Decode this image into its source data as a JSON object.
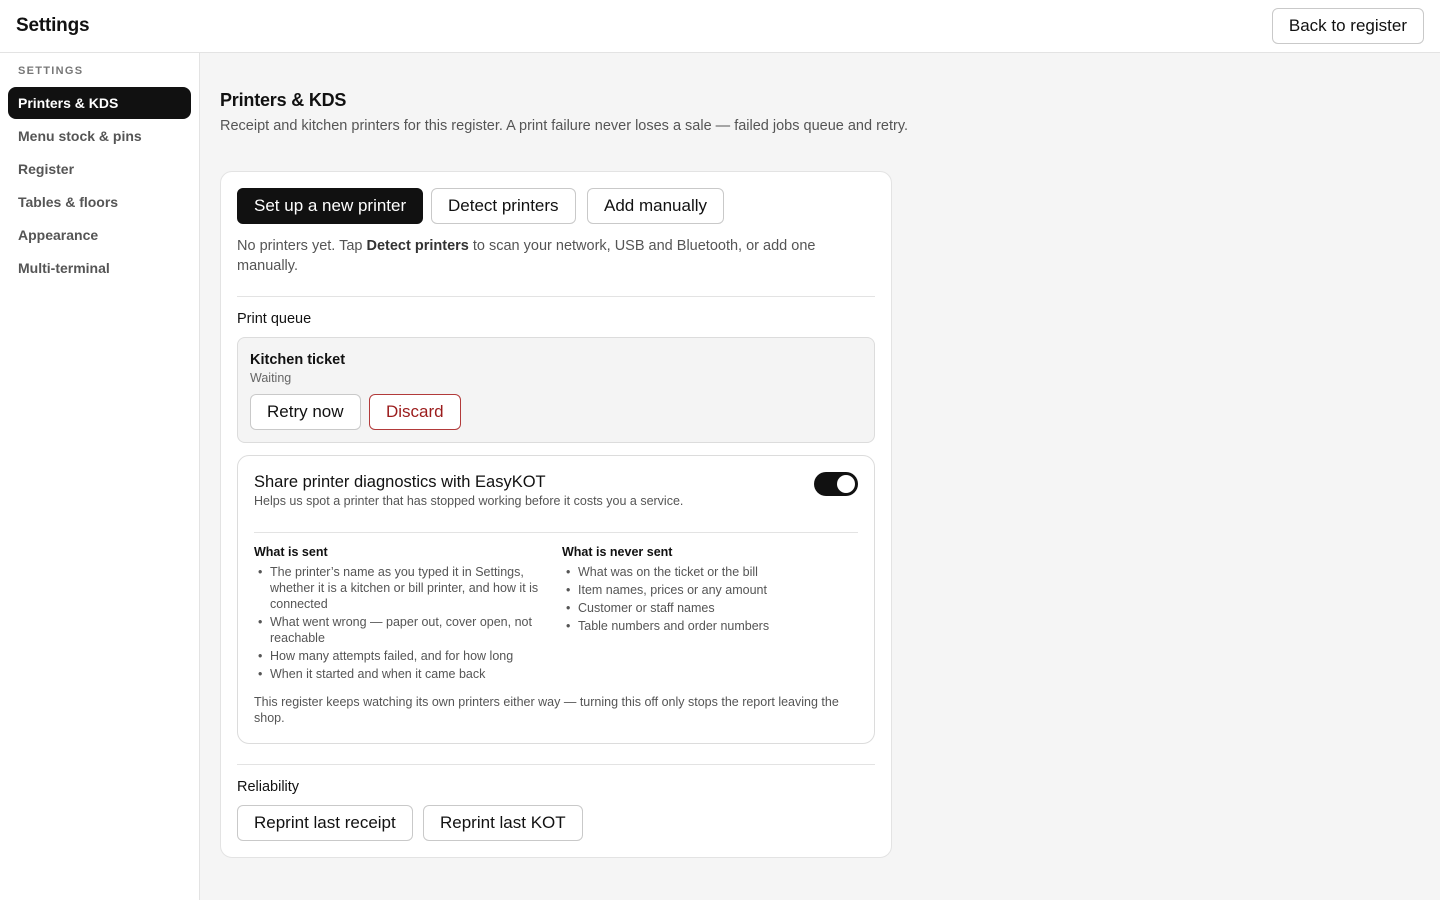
{
  "header": {
    "title": "Settings",
    "back_label": "Back to register"
  },
  "sidebar": {
    "heading": "SETTINGS",
    "items": [
      {
        "label": "Printers & KDS",
        "active": true
      },
      {
        "label": "Menu stock & pins",
        "active": false
      },
      {
        "label": "Register",
        "active": false
      },
      {
        "label": "Tables & floors",
        "active": false
      },
      {
        "label": "Appearance",
        "active": false
      },
      {
        "label": "Multi-terminal",
        "active": false
      }
    ]
  },
  "main": {
    "title": "Printers & KDS",
    "description": "Receipt and kitchen printers for this register. A print failure never loses a sale — failed jobs queue and retry.",
    "actions": {
      "setup_label": "Set up a new printer",
      "detect_label": "Detect printers",
      "manual_label": "Add manually"
    },
    "empty": {
      "before": "No printers yet. Tap ",
      "bold": "Detect printers",
      "after": " to scan your network, USB and Bluetooth, or add one manually."
    },
    "print_queue": {
      "label": "Print queue",
      "job_title": "Kitchen ticket",
      "job_status": "Waiting",
      "retry_label": "Retry now",
      "discard_label": "Discard"
    },
    "diagnostics": {
      "title": "Share printer diagnostics with EasyKOT",
      "subtitle": "Helps us spot a printer that has stopped working before it costs you a service.",
      "enabled": true,
      "sent_title": "What is sent",
      "sent_items": [
        "The printer’s name as you typed it in Settings, whether it is a kitchen or bill printer, and how it is connected",
        "What went wrong — paper out, cover open, not reachable",
        "How many attempts failed, and for how long",
        "When it started and when it came back"
      ],
      "never_title": "What is never sent",
      "never_items": [
        "What was on the ticket or the bill",
        "Item names, prices or any amount",
        "Customer or staff names",
        "Table numbers and order numbers"
      ],
      "footnote": "This register keeps watching its own printers either way — turning this off only stops the report leaving the shop."
    },
    "reliability": {
      "label": "Reliability",
      "reprint_receipt_label": "Reprint last receipt",
      "reprint_kot_label": "Reprint last KOT"
    }
  }
}
